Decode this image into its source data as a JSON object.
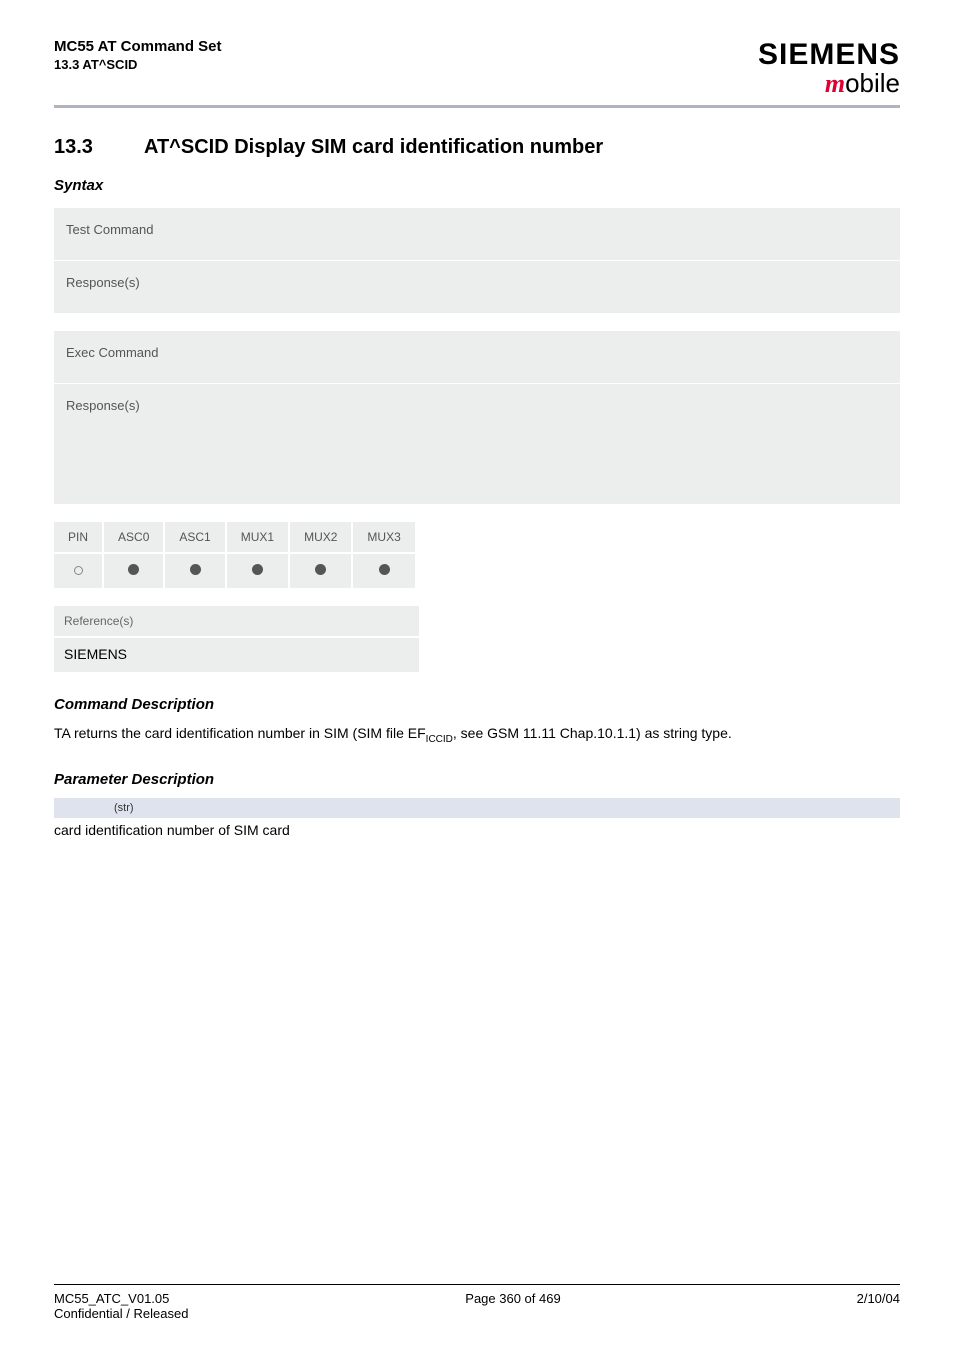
{
  "header": {
    "title": "MC55 AT Command Set",
    "subtitle": "13.3 AT^SCID",
    "logo_top": "SIEMENS",
    "logo_bottom_m": "m",
    "logo_bottom_rest": "obile"
  },
  "section": {
    "number": "13.3",
    "title": "AT^SCID   Display SIM card identification number"
  },
  "syntax_label": "Syntax",
  "blocks": {
    "test_cmd": "Test Command",
    "test_resp": "Response(s)",
    "exec_cmd": "Exec Command",
    "exec_resp": "Response(s)"
  },
  "pin_table": {
    "headers": [
      "PIN",
      "ASC0",
      "ASC1",
      "MUX1",
      "MUX2",
      "MUX3"
    ],
    "row": [
      "empty",
      "filled",
      "filled",
      "filled",
      "filled",
      "filled"
    ]
  },
  "reference": {
    "head": "Reference(s)",
    "body": "SIEMENS"
  },
  "cmd_desc": {
    "heading": "Command Description",
    "text_pre": "TA returns the card identification number in SIM (SIM file EF",
    "text_sub": "ICCID",
    "text_post": ", see GSM 11.11 Chap.10.1.1) as string type."
  },
  "param_desc": {
    "heading": "Parameter Description",
    "bar": "(str)",
    "text": "card identification number of SIM card"
  },
  "footer": {
    "left1": "MC55_ATC_V01.05",
    "left2": "Confidential / Released",
    "center": "Page 360 of 469",
    "right": "2/10/04"
  }
}
